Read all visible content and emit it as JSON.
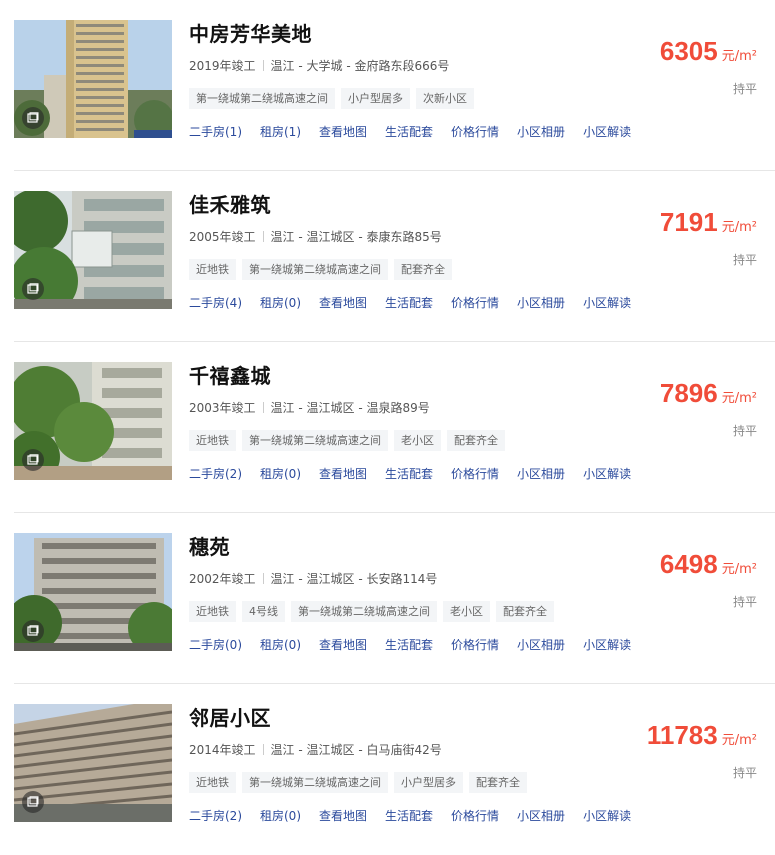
{
  "links_labels": [
    "二手房",
    "租房",
    "查看地图",
    "生活配套",
    "价格行情",
    "小区相册",
    "小区解读"
  ],
  "price_unit": "元/m²",
  "colors": {
    "price": "#f04c39",
    "link": "#2b4a9c",
    "tag_bg": "#f3f5f7"
  },
  "icons": {
    "album": "album-icon"
  },
  "listings": [
    {
      "name": "中房芳华美地",
      "year": "2019年竣工",
      "location": "温江 - 大学城 - 金府路东段666号",
      "tags": [
        "第一绕城第二绕城高速之间",
        "小户型居多",
        "次新小区"
      ],
      "secondhand": "二手房(1)",
      "rent": "租房(1)",
      "price": "6305",
      "trend": "持平"
    },
    {
      "name": "佳禾雅筑",
      "year": "2005年竣工",
      "location": "温江 - 温江城区 - 泰康东路85号",
      "tags": [
        "近地铁",
        "第一绕城第二绕城高速之间",
        "配套齐全"
      ],
      "secondhand": "二手房(4)",
      "rent": "租房(0)",
      "price": "7191",
      "trend": "持平"
    },
    {
      "name": "千禧鑫城",
      "year": "2003年竣工",
      "location": "温江 - 温江城区 - 温泉路89号",
      "tags": [
        "近地铁",
        "第一绕城第二绕城高速之间",
        "老小区",
        "配套齐全"
      ],
      "secondhand": "二手房(2)",
      "rent": "租房(0)",
      "price": "7896",
      "trend": "持平"
    },
    {
      "name": "穗苑",
      "year": "2002年竣工",
      "location": "温江 - 温江城区 - 长安路114号",
      "tags": [
        "近地铁",
        "4号线",
        "第一绕城第二绕城高速之间",
        "老小区",
        "配套齐全"
      ],
      "secondhand": "二手房(0)",
      "rent": "租房(0)",
      "price": "6498",
      "trend": "持平"
    },
    {
      "name": "邻居小区",
      "year": "2014年竣工",
      "location": "温江 - 温江城区 - 白马庙街42号",
      "tags": [
        "近地铁",
        "第一绕城第二绕城高速之间",
        "小户型居多",
        "配套齐全"
      ],
      "secondhand": "二手房(2)",
      "rent": "租房(0)",
      "price": "11783",
      "trend": "持平"
    }
  ]
}
